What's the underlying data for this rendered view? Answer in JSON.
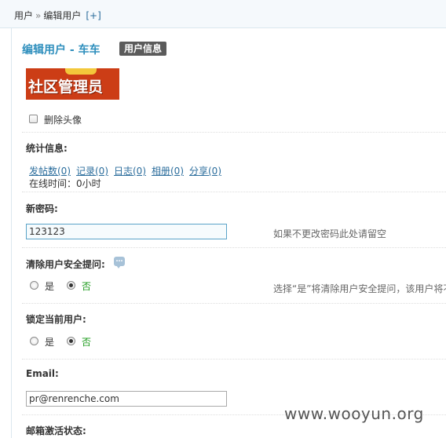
{
  "breadcrumb": {
    "root": "用户",
    "separator": "»",
    "current": "编辑用户",
    "add": "[+]"
  },
  "page": {
    "title": "编辑用户 - 车车",
    "badge": "用户信息"
  },
  "avatar": {
    "text": "社区管理员",
    "delete_label": "删除头像",
    "delete_checked": false
  },
  "stats": {
    "title": "统计信息:",
    "links": [
      "发帖数(0)",
      "记录(0)",
      "日志(0)",
      "相册(0)",
      "分享(0)"
    ],
    "online_time": "在线时间：0小时"
  },
  "password": {
    "label": "新密码:",
    "value": "123123",
    "hint": "如果不更改密码此处请留空"
  },
  "clear_security": {
    "label": "清除用户安全提问:",
    "yes": "是",
    "no": "否",
    "selected": "否",
    "hint": "选择“是”将清除用户安全提问，该用户将不"
  },
  "lock_user": {
    "label": "锁定当前用户:",
    "yes": "是",
    "no": "否",
    "selected": "否"
  },
  "email": {
    "label": "Email:",
    "value": "pr@renrenche.com"
  },
  "email_status": {
    "label": "邮箱激活状态:"
  },
  "watermark": "www.wooyun.org",
  "colors": {
    "accent": "#2f8fbd",
    "link": "#2b6d9c",
    "selected_option": "#1a9a1a",
    "avatar_bg": "#cc3d16"
  }
}
